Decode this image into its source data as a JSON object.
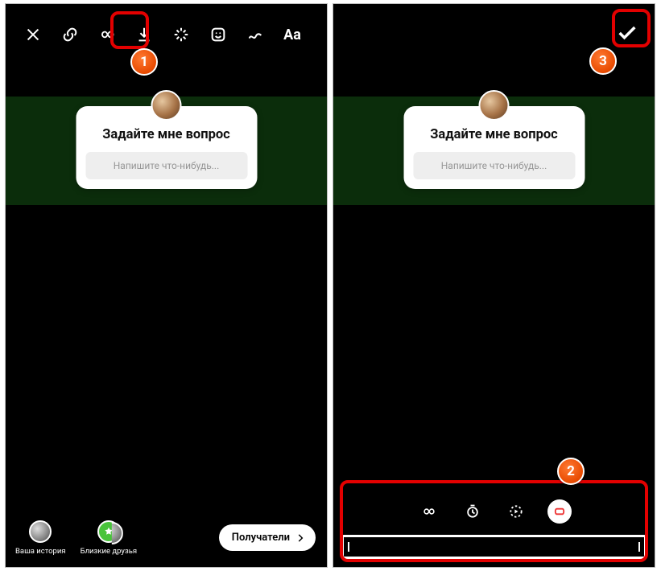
{
  "steps": {
    "one": "1",
    "two": "2",
    "three": "3"
  },
  "question_card": {
    "title": "Задайте мне вопрос",
    "placeholder": "Напишите что-нибудь..."
  },
  "left": {
    "toolbar_icons": {
      "close": "close-icon",
      "link": "link-icon",
      "boomerang": "infinity-icon",
      "download": "download-icon",
      "effects": "sparkle-icon",
      "sticker": "sticker-icon",
      "draw": "draw-icon",
      "text": "Aa"
    },
    "destinations": {
      "your_story": "Ваша история",
      "close_friends": "Близкие друзья"
    },
    "recipients_button": "Получатели"
  },
  "right": {
    "done_icon": "check-icon",
    "trim_modes": {
      "loop": "infinity-icon",
      "timer": "timer-icon",
      "slowmo": "slowmo-icon",
      "boomerang": "boomerang-icon"
    }
  }
}
